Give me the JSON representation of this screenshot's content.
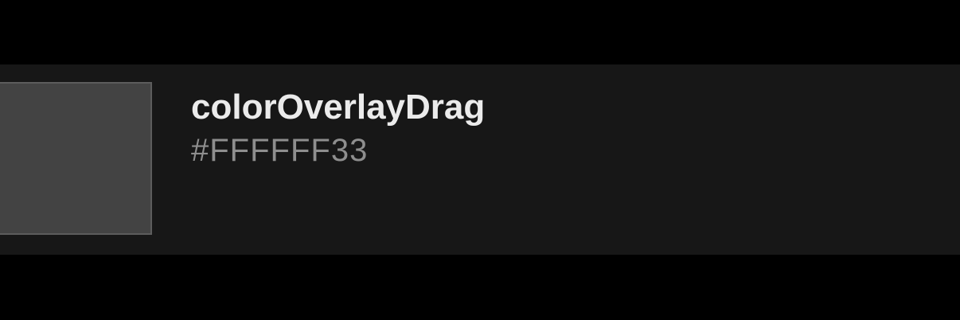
{
  "color_token": {
    "name": "colorOverlayDrag",
    "value": "#FFFFFF33",
    "swatch_color": "#434343"
  },
  "colors": {
    "background": "#000000",
    "row_background": "#171717",
    "swatch_border": "#5c5c5c",
    "name_text": "#ebebeb",
    "value_text": "#8e8e8e"
  }
}
